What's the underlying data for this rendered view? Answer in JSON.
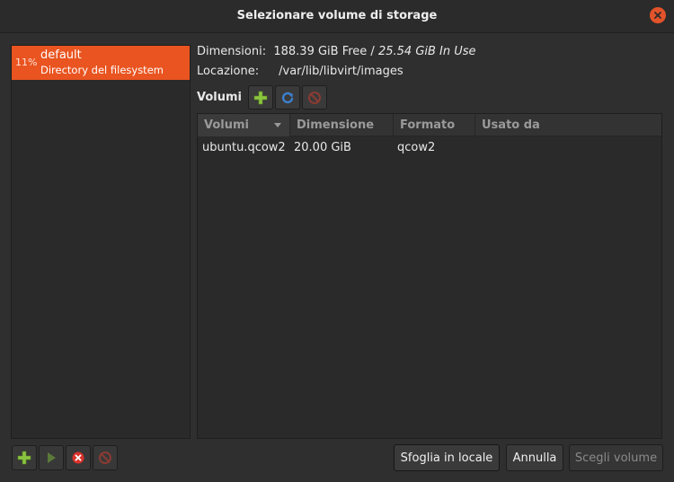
{
  "window": {
    "title": "Selezionare volume di storage"
  },
  "pools": [
    {
      "percent": "11%",
      "name": "default",
      "type": "Directory del filesystem",
      "selected": true
    }
  ],
  "details": {
    "size_label": "Dimensioni:",
    "free": "188.39 GiB Free /",
    "in_use": "25.54 GiB In Use",
    "location_label": "Locazione:",
    "location": "/var/lib/libvirt/images"
  },
  "volumes": {
    "title": "Volumi",
    "columns": [
      "Volumi",
      "Dimensione",
      "Formato",
      "Usato da"
    ],
    "rows": [
      {
        "name": "ubuntu.qcow2",
        "size": "20.00 GiB",
        "format": "qcow2",
        "used_by": ""
      }
    ]
  },
  "buttons": {
    "browse_local": "Sfoglia in locale",
    "cancel": "Annulla",
    "choose_volume": "Scegli volume"
  },
  "colors": {
    "accent": "#e95420",
    "add_icon": "#8bc43f",
    "refresh_icon": "#3d7fcf",
    "stop_icon": "#c0392b"
  }
}
